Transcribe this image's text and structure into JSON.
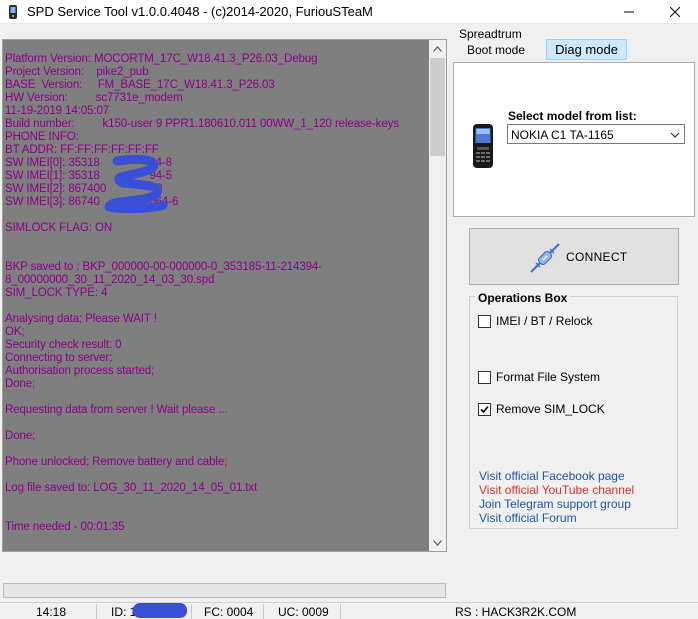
{
  "window": {
    "title": "SPD Service Tool v1.0.0.4048 - (c)2014-2020, FuriouSTeaM",
    "min_glyph": "–",
    "close_glyph": "✕"
  },
  "log": {
    "lines": [
      "Platform Version: MOCORTM_17C_W18.41.3_P26.03_Debug",
      "Project Version:    pike2_pub",
      "BASE  Version:     FM_BASE_17C_W18.41.3_P26.03",
      "HW Version:         sc7731e_modem",
      "11-19-2019 14:05:07",
      "Build number:         k150-user 9 PPR1.180610.011 00WW_1_120 release-keys",
      "PHONE INFO:",
      "BT ADDR: FF:FF:FF:FF:FF:FF",
      "SW IMEI[0]: 35318                94-8",
      "SW IMEI[1]: 35318                94-5",
      "SW IMEI[2]: 867400               -8",
      "SW IMEI[3]: 86740                064-6",
      "",
      "SIMLOCK FLAG: ON",
      "",
      "",
      "BKP saved to : BKP_000000-00-000000-0_353185-11-214394-",
      "8_00000000_30_11_2020_14_03_30.spd",
      "SIM_LOCK TYPE: 4",
      "",
      "Analysing data; Please WAIT !",
      "OK;",
      "Security check result: 0",
      "Connecting to server;",
      "Authorisation process started;",
      "Done;",
      "",
      "Requesting data from server ! Wait please ...",
      "",
      "Done;",
      "",
      "Phone unlocked; Remove battery and cable;",
      "",
      "Log file saved to: LOG_30_11_2020_14_05_01.txt",
      "",
      "",
      "Time needed - 00:01:35"
    ]
  },
  "panel": {
    "group_label": "Spreadtrum",
    "tabs": [
      {
        "label": "Boot mode",
        "selected": false
      },
      {
        "label": "Diag mode",
        "selected": true
      }
    ],
    "select_model_label": "Select model from list:",
    "selected_model": "NOKIA C1 TA-1165",
    "connect_label": "CONNECT",
    "operations_title": "Operations Box",
    "options": [
      {
        "label": "IMEI / BT / Relock",
        "checked": false
      },
      {
        "label": "Format File System",
        "checked": false
      },
      {
        "label": "Remove SIM_LOCK",
        "checked": true
      }
    ],
    "links": [
      {
        "label": "Visit official Facebook page",
        "color": "#1e56a8"
      },
      {
        "label": "Visit official YouTube channel",
        "color": "#d9342b"
      },
      {
        "label": "Join Telegram support group",
        "color": "#1e56a8"
      },
      {
        "label": "Visit official Forum",
        "color": "#1e56a8"
      }
    ]
  },
  "status": {
    "time": "14:18",
    "id": "ID: 11",
    "fc": "FC: 0004",
    "uc": "UC: 0009",
    "rs": "RS : HACK3R2K.COM"
  },
  "colors": {
    "log_text": "#8b008b",
    "log_bg": "#7f7f7f",
    "redaction": "#3a4fd8"
  }
}
